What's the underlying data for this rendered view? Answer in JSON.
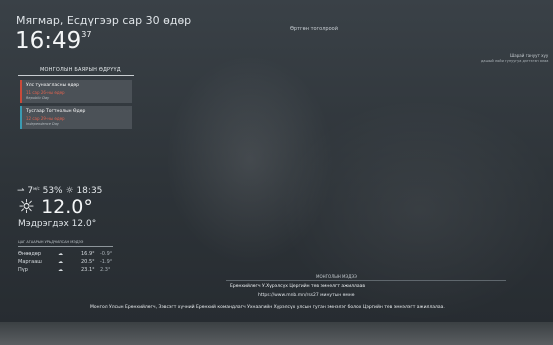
{
  "header": {
    "date": "Мягмар, Есдүгээр сар 30 өдөр",
    "time_hm": "16:49",
    "time_s": "37"
  },
  "top_center_text": "Өртгөн тоголроой",
  "top_right": {
    "line1": "Шарай гануут хуу",
    "line2": "дашый лойи гунуугуа дэгтэгэн ялаа"
  },
  "holidays": {
    "title": "МОНГОЛЫН БАЯРЫН ӨДРҮҮД",
    "items": [
      {
        "name": "Улс тунхагласны өдөр",
        "date": "11 сар 26-ны өдөр",
        "english": "Republic Day",
        "color": "#c94a3a"
      },
      {
        "name": "Тусгаар Тогтнолын Өдөр",
        "date": "12 сар 29-ны өдөр",
        "english": "Independence Day",
        "color": "#3a9bb2"
      }
    ]
  },
  "weather": {
    "wind": "7",
    "wind_unit": "м/с",
    "humidity": "53%",
    "sunset": "18:35",
    "temperature": "12.0°",
    "feels_like": "Мэдрэгдэх 12.0°",
    "forecast_title": "ЦАГ АГААРЫН УРЬДЧИЛСАН МЭДЭЭ",
    "forecast": [
      {
        "day": "Өнөөдөр",
        "icon": "cloud-icon",
        "high": "16.9°",
        "low": "-0.9°"
      },
      {
        "day": "Маргааш",
        "icon": "cloud-icon",
        "high": "20.5°",
        "low": "-1.9°"
      },
      {
        "day": "Пүр",
        "icon": "cloud-icon",
        "high": "23.1°",
        "low": "2.3°"
      }
    ]
  },
  "news": {
    "title": "МОНГОЛЫН МЭДЭЭ",
    "line1": "Ерөнхийлөгч У.Хүрэлсүх Цергийн тев эмнелгт ажиллаав",
    "line2": "https://www.mnb.mn/rss27 минутын өмнө",
    "line3": "Монгол Улсын Ерөнхийлөгч, Зэвсэгт хүчний Ерөнхий командлагч Ухнаагийн Хүрэлсүх улсын гуган эмнэлэг болох Цэргийн тев эмнэлэгт ажиллалаа."
  }
}
